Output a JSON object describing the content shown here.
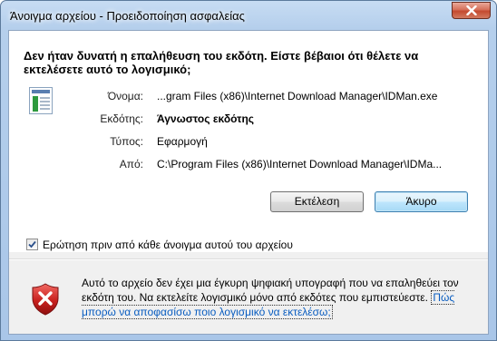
{
  "window": {
    "title": "Άνοιγμα αρχείου - Προειδοποίηση ασφαλείας",
    "close_icon": "close-icon"
  },
  "heading": "Δεν ήταν δυνατή η επαλήθευση του εκδότη. Είστε βέβαιοι ότι θέλετε να εκτελέσετε αυτό το λογισμικό;",
  "details": {
    "file_icon": "application-file-icon",
    "name_label": "Όνομα:",
    "name_value": "...gram Files (x86)\\Internet Download Manager\\IDMan.exe",
    "publisher_label": "Εκδότης:",
    "publisher_value": "Άγνωστος εκδότης",
    "type_label": "Τύπος:",
    "type_value": "Εφαρμογή",
    "from_label": "Από:",
    "from_value": "C:\\Program Files (x86)\\Internet Download Manager\\IDMa..."
  },
  "buttons": {
    "run": "Εκτέλεση",
    "cancel": "Άκυρο"
  },
  "checkbox": {
    "label": "Ερώτηση πριν από κάθε άνοιγμα αυτού του αρχείου",
    "checked": true
  },
  "warning": {
    "icon": "security-shield-icon",
    "text": "Αυτό το αρχείο δεν έχει μια έγκυρη ψηφιακή υπογραφή που να επαληθεύει τον εκδότη του. Να εκτελείτε λογισμικό μόνο από εκδότες που εμπιστεύεστε.",
    "link": "Πώς μπορώ να αποφασίσω ποιο λογισμικό να εκτελέσω;"
  },
  "colors": {
    "title_bar": "#b5cfec",
    "close_button": "#c44a2f",
    "link": "#0a5dc0",
    "shield_red": "#c8201e"
  }
}
